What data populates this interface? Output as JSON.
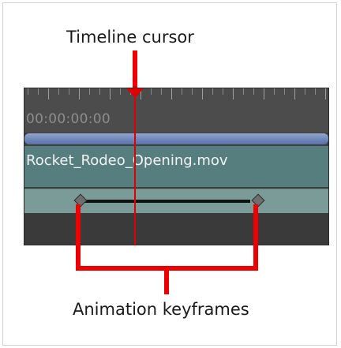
{
  "labels": {
    "top": "Timeline cursor",
    "bottom": "Animation keyframes"
  },
  "timeline": {
    "timecode": "00:00:00:00",
    "clip_name": "Rocket_Rodeo_Opening.mov"
  },
  "colors": {
    "callout": "#ee0000",
    "clip": "#577e7e",
    "keyframe_track": "#7b9b98",
    "work_area_bar": "#6f87b9"
  }
}
